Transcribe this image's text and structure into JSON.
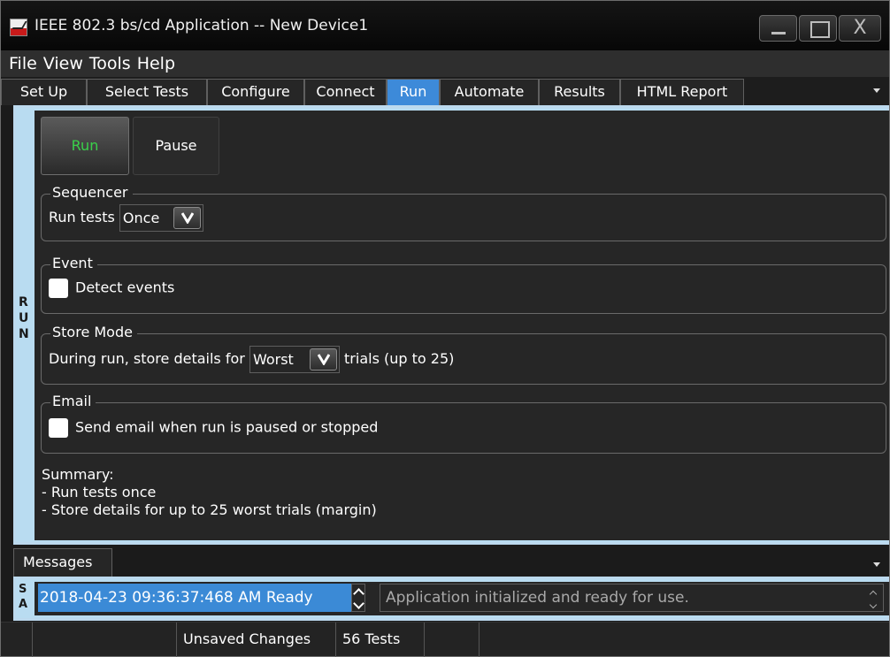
{
  "window": {
    "title": "IEEE 802.3 bs/cd Application -- New Device1",
    "close_glyph": "X"
  },
  "menu": [
    "File",
    "View",
    "Tools",
    "Help"
  ],
  "tabs": [
    {
      "label": "Set Up",
      "active": false
    },
    {
      "label": "Select Tests",
      "active": false
    },
    {
      "label": "Configure",
      "active": false
    },
    {
      "label": "Connect",
      "active": false
    },
    {
      "label": "Run",
      "active": true
    },
    {
      "label": "Automate",
      "active": false
    },
    {
      "label": "Results",
      "active": false
    },
    {
      "label": "HTML Report",
      "active": false
    }
  ],
  "side_label": [
    "R",
    "U",
    "N"
  ],
  "run_panel": {
    "run_label": "Run",
    "pause_label": "Pause",
    "sequencer": {
      "title": "Sequencer",
      "label": "Run tests",
      "value": "Once"
    },
    "event": {
      "title": "Event",
      "checkbox_label": "Detect events",
      "checked": false
    },
    "store_mode": {
      "title": "Store Mode",
      "label_before": "During run, store details for",
      "value": "Worst",
      "label_after": "trials (up to 25)"
    },
    "email": {
      "title": "Email",
      "checkbox_label": "Send email when run is paused or stopped",
      "checked": false
    },
    "summary": {
      "title": "Summary:",
      "lines": [
        "- Run tests once",
        "- Store details for up to 25 worst trials (margin)"
      ]
    }
  },
  "messages": {
    "tab_label": "Messages",
    "side_label": [
      "S",
      "A"
    ],
    "selected": "2018-04-23 09:36:37:468 AM Ready",
    "detail": "Application initialized and ready for use."
  },
  "status": {
    "unsaved": "Unsaved Changes",
    "tests": "56 Tests"
  },
  "colors": {
    "accent": "#3d8ad9",
    "run_text": "#3ad04a",
    "frame": "#b9dcf1",
    "panel": "#262626"
  }
}
